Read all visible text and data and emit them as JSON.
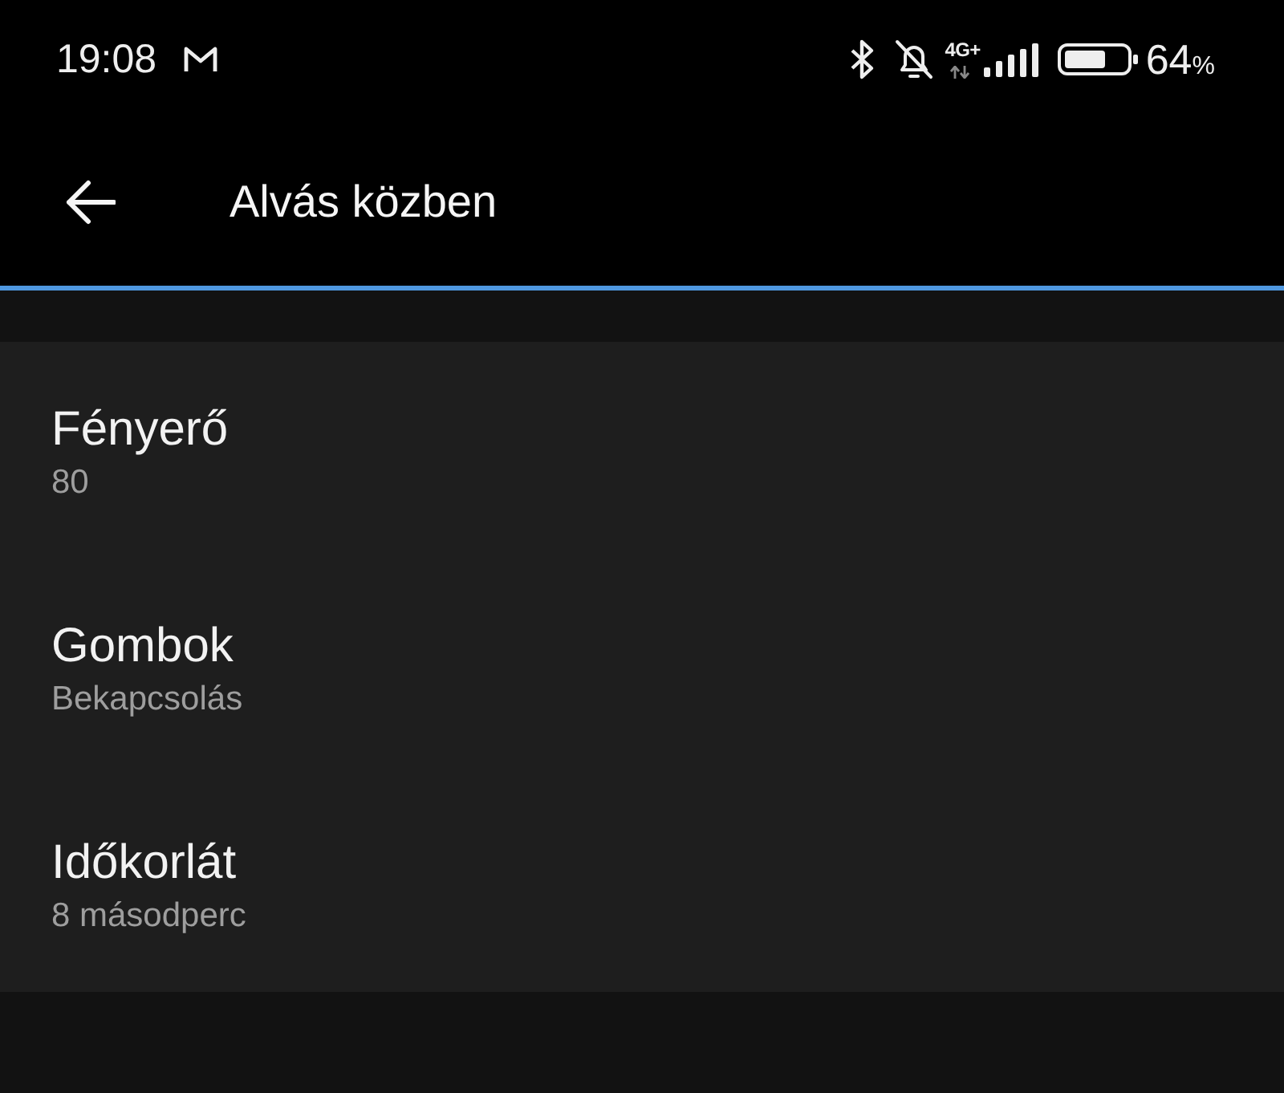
{
  "status_bar": {
    "time": "19:08",
    "network_type": "4G+",
    "battery_percent": "64",
    "battery_unit": "%"
  },
  "toolbar": {
    "title": "Alvás közben"
  },
  "settings": [
    {
      "title": "Fényerő",
      "value": "80"
    },
    {
      "title": "Gombok",
      "value": "Bekapcsolás"
    },
    {
      "title": "Időkorlát",
      "value": "8 másodperc"
    }
  ]
}
